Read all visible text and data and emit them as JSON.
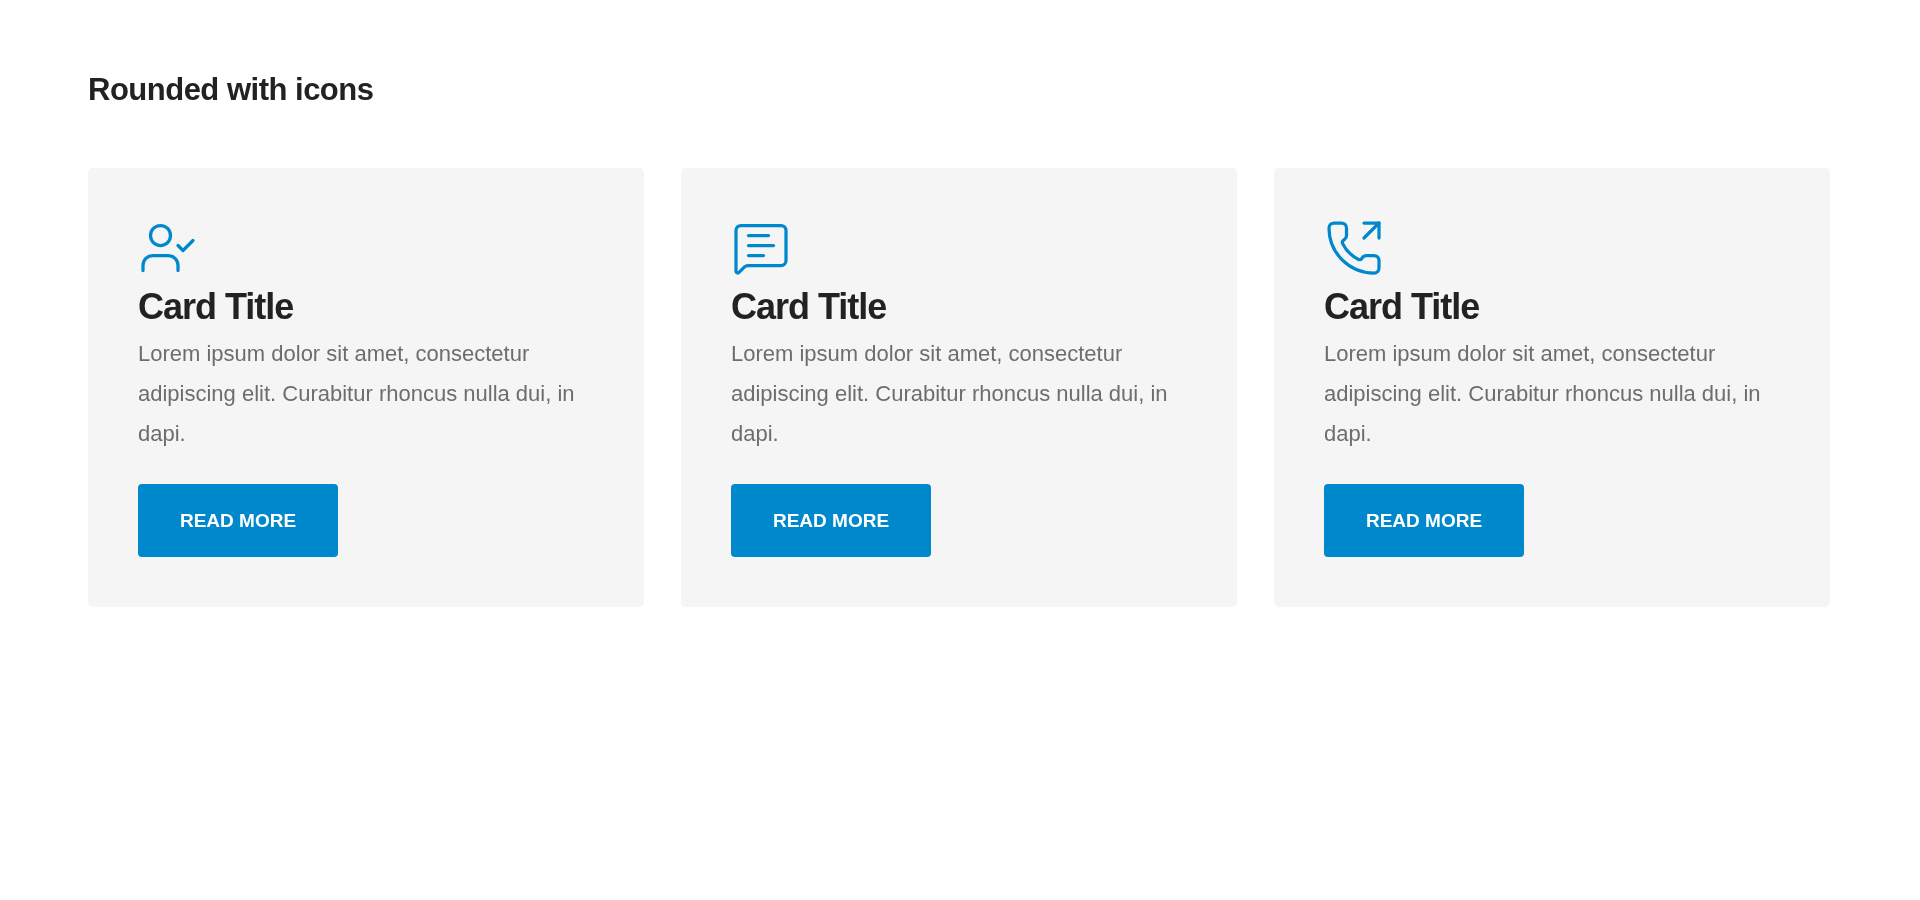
{
  "heading": "Rounded with icons",
  "cards": [
    {
      "title": "Card Title",
      "text": "Lorem ipsum dolor sit amet, consectetur adipiscing elit. Curabitur rhoncus nulla dui, in dapi.",
      "button": "READ MORE"
    },
    {
      "title": "Card Title",
      "text": "Lorem ipsum dolor sit amet, consectetur adipiscing elit. Curabitur rhoncus nulla dui, in dapi.",
      "button": "READ MORE"
    },
    {
      "title": "Card Title",
      "text": "Lorem ipsum dolor sit amet, consectetur adipiscing elit. Curabitur rhoncus nulla dui, in dapi.",
      "button": "READ MORE"
    }
  ]
}
